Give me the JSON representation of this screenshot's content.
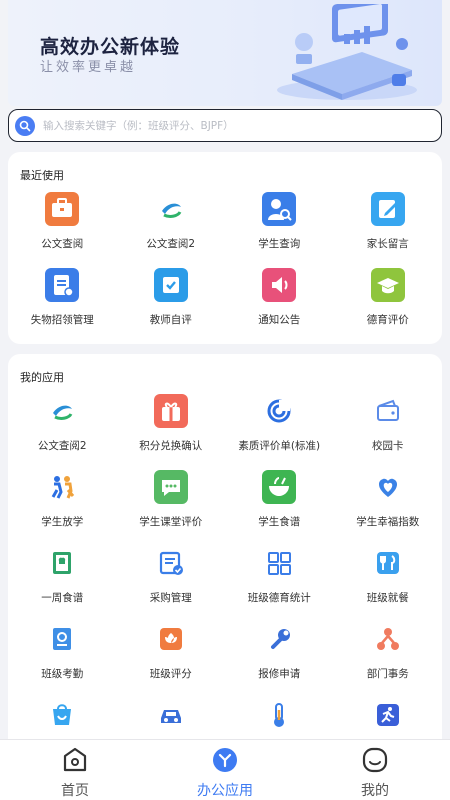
{
  "banner": {
    "title": "高效办公新体验",
    "subtitle": "让效率更卓越"
  },
  "search": {
    "placeholder": "输入搜索关键字（例：班级评分、BJPF）"
  },
  "recent": {
    "title": "最近使用",
    "items": [
      {
        "label": "公文查阅",
        "icon": "briefcase-icon",
        "color": "#f07b3f"
      },
      {
        "label": "公文查阅2",
        "icon": "globe-logo-icon",
        "color": "#2a8fd6"
      },
      {
        "label": "学生查询",
        "icon": "student-search-icon",
        "color": "#3a7ee8"
      },
      {
        "label": "家长留言",
        "icon": "edit-note-icon",
        "color": "#37a6f0"
      },
      {
        "label": "失物招领管理",
        "icon": "document-edit-icon",
        "color": "#3b7de8"
      },
      {
        "label": "教师自评",
        "icon": "checkbox-icon",
        "color": "#2b9ce8"
      },
      {
        "label": "通知公告",
        "icon": "speaker-icon",
        "color": "#e8517a"
      },
      {
        "label": "德育评价",
        "icon": "graduation-cap-icon",
        "color": "#8fc53d"
      }
    ]
  },
  "apps": {
    "title": "我的应用",
    "items": [
      {
        "label": "公文查阅2",
        "icon": "globe-logo-icon",
        "color": "#2a8fd6"
      },
      {
        "label": "积分兑换确认",
        "icon": "gift-icon",
        "color": "#f26a5a"
      },
      {
        "label": "素质评价单(标准)",
        "icon": "swirl-icon",
        "color": "#2d6fe0"
      },
      {
        "label": "校园卡",
        "icon": "wallet-icon",
        "color": "#5b8be8"
      },
      {
        "label": "学生放学",
        "icon": "children-icon",
        "color": "#2c6fe2"
      },
      {
        "label": "学生课堂评价",
        "icon": "chat-bubble-icon",
        "color": "#56b964"
      },
      {
        "label": "学生食谱",
        "icon": "food-bowl-icon",
        "color": "#3eb552"
      },
      {
        "label": "学生幸福指数",
        "icon": "heart-icon",
        "color": "#3b82e6"
      },
      {
        "label": "一周食谱",
        "icon": "chef-book-icon",
        "color": "#2ea36a"
      },
      {
        "label": "采购管理",
        "icon": "purchase-doc-icon",
        "color": "#3a7ee8"
      },
      {
        "label": "班级德育统计",
        "icon": "grid-stats-icon",
        "color": "#3b7de8"
      },
      {
        "label": "班级就餐",
        "icon": "fork-knife-icon",
        "color": "#3aa0ee"
      },
      {
        "label": "班级考勤",
        "icon": "attendance-book-icon",
        "color": "#3f8fe6"
      },
      {
        "label": "班级评分",
        "icon": "flower-score-icon",
        "color": "#f07b3f"
      },
      {
        "label": "报修申请",
        "icon": "wrench-icon",
        "color": "#3a6fd8"
      },
      {
        "label": "部门事务",
        "icon": "network-icon",
        "color": "#f07b5f"
      },
      {
        "label": "",
        "icon": "shopping-bag-icon",
        "color": "#37a6f0"
      },
      {
        "label": "",
        "icon": "car-icon",
        "color": "#3a6fd8"
      },
      {
        "label": "",
        "icon": "thermometer-icon",
        "color": "#3a7ee8"
      },
      {
        "label": "",
        "icon": "running-icon",
        "color": "#3a5fd8"
      }
    ]
  },
  "tabbar": {
    "active_color": "#3e7bf2",
    "tabs": [
      {
        "label": "首页",
        "icon": "home-icon"
      },
      {
        "label": "办公应用",
        "icon": "office-apps-icon",
        "active": true
      },
      {
        "label": "我的",
        "icon": "profile-smile-icon"
      }
    ]
  }
}
